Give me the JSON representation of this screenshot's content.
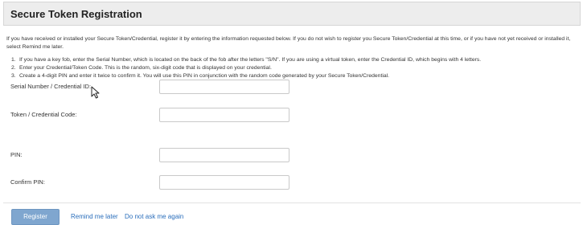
{
  "header": {
    "title": "Secure Token Registration"
  },
  "intro": {
    "text": "If you have received or installed your Secure Token/Credential, register it by entering the information requested below. If you do not wish to register you Secure Token/Credential at this time, or if you have not yet received or installed it, select Remind me later."
  },
  "steps": [
    {
      "number": "1.",
      "text": "If you have a key fob, enter the Serial Number, which is located on the back of the fob after the letters \"S/N\". If you are using a virtual token, enter the Credential ID, which begins with 4 letters."
    },
    {
      "number": "2.",
      "text": "Enter your Credential/Token Code. This is the random, six-digit code that is displayed on your credential."
    },
    {
      "number": "3.",
      "text": "Create a 4-digit PIN and enter it twice to confirm it. You will use this PIN in conjunction with the random code generated by your Secure Token/Credential."
    }
  ],
  "form": {
    "serial": {
      "label": "Serial Number / Credential ID:",
      "value": ""
    },
    "token_code": {
      "label": "Token / Credential Code:",
      "value": ""
    },
    "pin": {
      "label": "PIN:",
      "value": ""
    },
    "confirm_pin": {
      "label": "Confirm PIN:",
      "value": ""
    }
  },
  "actions": {
    "register_label": "Register",
    "remind_label": "Remind me later",
    "do_not_ask_label": "Do not ask me again"
  },
  "colors": {
    "register_button": "#7fa6cf",
    "link": "#2a6ebb",
    "title_bar": "#ededed"
  },
  "icons": {
    "cursor": "mouse-pointer-icon"
  }
}
